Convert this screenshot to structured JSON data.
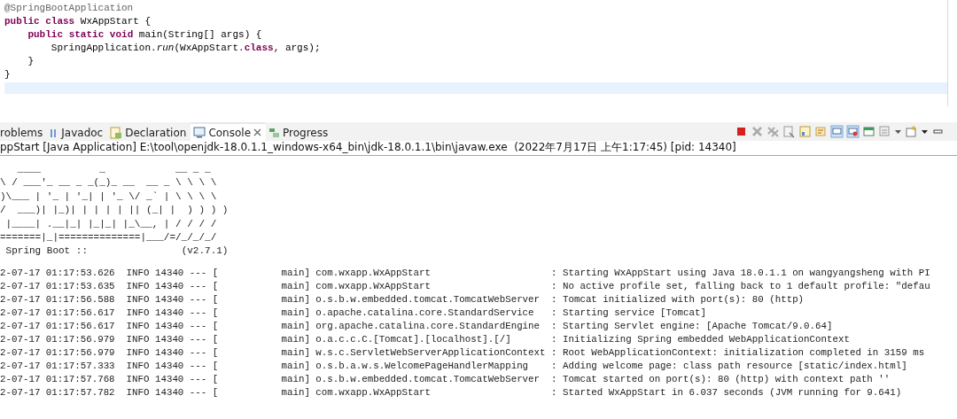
{
  "editor": {
    "lines": [
      "@SpringBootApplication",
      "**public** **class** WxAppStart {",
      "    **public** **static** **void** main(String[] args) {",
      "        SpringApplication.*run*(WxAppStart.**class**, args);",
      "    }",
      "}"
    ]
  },
  "views": {
    "tabs": [
      {
        "label": "roblems",
        "selected": false,
        "closable": false
      },
      {
        "label": "Javadoc",
        "selected": false,
        "closable": false
      },
      {
        "label": "Declaration",
        "selected": false,
        "closable": false
      },
      {
        "label": "Console",
        "selected": true,
        "closable": true
      },
      {
        "label": "Progress",
        "selected": false,
        "closable": false
      }
    ]
  },
  "console": {
    "header": "ppStart [Java Application] E:\\tool\\openjdk-18.0.1.1_windows-x64_bin\\jdk-18.0.1.1\\bin\\javaw.exe  (2022年7月17日 上午1:17:45) [pid: 14340]",
    "banner": [
      "   ____          _            __ _ _",
      "\\ / ___'_ __ _ _(_)_ __  __ _ \\ \\ \\ \\",
      ")\\___ | '_ | '_| | '_ \\/ _` | \\ \\ \\ \\",
      "/  ___)| |_)| | | | | || (_| |  ) ) ) )",
      " |____| .__|_| |_|_| |_\\__, | / / / /",
      "=======|_|==============|___/=/_/_/_/",
      " Spring Boot ::                (v2.7.1)"
    ],
    "log": [
      "2-07-17 01:17:53.626  INFO 14340 --- [           main] com.wxapp.WxAppStart                     : Starting WxAppStart using Java 18.0.1.1 on wangyangsheng with PI",
      "2-07-17 01:17:53.635  INFO 14340 --- [           main] com.wxapp.WxAppStart                     : No active profile set, falling back to 1 default profile: \"defau",
      "2-07-17 01:17:56.588  INFO 14340 --- [           main] o.s.b.w.embedded.tomcat.TomcatWebServer  : Tomcat initialized with port(s): 80 (http)",
      "2-07-17 01:17:56.617  INFO 14340 --- [           main] o.apache.catalina.core.StandardService   : Starting service [Tomcat]",
      "2-07-17 01:17:56.617  INFO 14340 --- [           main] org.apache.catalina.core.StandardEngine  : Starting Servlet engine: [Apache Tomcat/9.0.64]",
      "2-07-17 01:17:56.979  INFO 14340 --- [           main] o.a.c.c.C.[Tomcat].[localhost].[/]       : Initializing Spring embedded WebApplicationContext",
      "2-07-17 01:17:56.979  INFO 14340 --- [           main] w.s.c.ServletWebServerApplicationContext : Root WebApplicationContext: initialization completed in 3159 ms",
      "2-07-17 01:17:57.333  INFO 14340 --- [           main] o.s.b.a.w.s.WelcomePageHandlerMapping    : Adding welcome page: class path resource [static/index.html]",
      "2-07-17 01:17:57.768  INFO 14340 --- [           main] o.s.b.w.embedded.tomcat.TomcatWebServer  : Tomcat started on port(s): 80 (http) with context path ''",
      "2-07-17 01:17:57.782  INFO 14340 --- [           main] com.wxapp.WxAppStart                     : Started WxAppStart in 6.037 seconds (JVM running for 9.641)"
    ]
  }
}
